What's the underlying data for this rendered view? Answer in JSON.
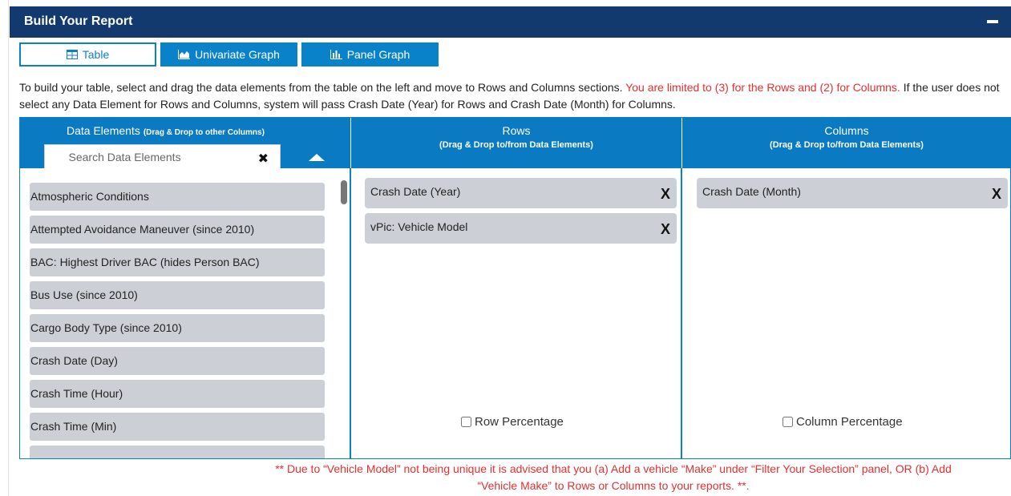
{
  "panel": {
    "title": "Build Your Report",
    "collapse_icon": "minus-icon"
  },
  "tabs": [
    {
      "label": "Table",
      "icon": "table-icon",
      "active": true
    },
    {
      "label": "Univariate Graph",
      "icon": "area-chart-icon",
      "active": false
    },
    {
      "label": "Panel Graph",
      "icon": "bar-chart-icon",
      "active": false
    }
  ],
  "intro": {
    "part1": "To build your table, select and drag the data elements from the table on the left and move to Rows and Columns sections. ",
    "part2_red": "You are limited to (3) for the Rows and (2) for Columns.",
    "part3": " If the user does not select any Data Element for Rows and Columns, system will pass Crash Date (Year) for Rows and Crash Date (Month) for Columns."
  },
  "data_elements": {
    "title": "Data Elements",
    "subtitle": "(Drag & Drop to other Columns)",
    "search_placeholder": "Search Data Elements",
    "search_value": "",
    "clear_symbol": "✖",
    "items": [
      "Atmospheric Conditions",
      "Attempted Avoidance Maneuver (since 2010)",
      "BAC: Highest Driver BAC (hides Person BAC)",
      "Bus Use (since 2010)",
      "Cargo Body Type (since 2010)",
      "Crash Date (Day)",
      "Crash Time (Hour)",
      "Crash Time (Min)",
      ""
    ]
  },
  "rows": {
    "title": "Rows",
    "subtitle": "(Drag & Drop to/from Data Elements)",
    "items": [
      "Crash Date (Year)",
      "vPic: Vehicle Model"
    ],
    "remove_symbol": "X",
    "percentage_label": "Row Percentage",
    "percentage_checked": false
  },
  "columns": {
    "title": "Columns",
    "subtitle": "(Drag & Drop to/from Data Elements)",
    "items": [
      "Crash Date (Month)"
    ],
    "remove_symbol": "X",
    "percentage_label": "Column Percentage",
    "percentage_checked": false
  },
  "footnote": {
    "line1": "** Due to “Vehicle Model” not being unique it is advised that you (a) Add a vehicle “Make” under “Filter Your Selection” panel, OR (b) Add",
    "line2": "“Vehicle Make” to Rows or Columns to your reports. **."
  },
  "colors": {
    "header_navy": "#123a6e",
    "accent_blue": "#0a82c9",
    "column_header": "#0a7ac3",
    "warning_red": "#e53030",
    "chip_gray": "#ccd0d6"
  }
}
